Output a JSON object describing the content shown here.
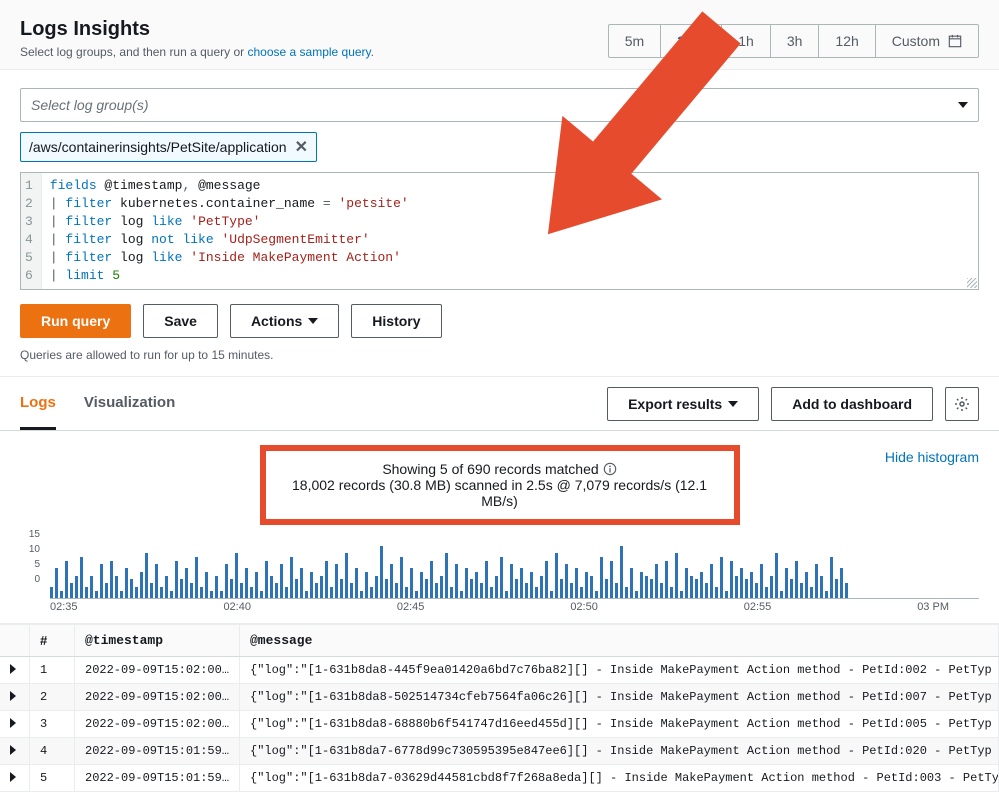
{
  "header": {
    "title": "Logs Insights",
    "subtitle_prefix": "Select log groups, and then run a query or ",
    "subtitle_link": "choose a sample query",
    "subtitle_suffix": "."
  },
  "timerange": {
    "items": [
      "5m",
      "30m",
      "1h",
      "3h",
      "12h"
    ],
    "active_index": 1,
    "custom": "Custom"
  },
  "log_select": {
    "placeholder": "Select log group(s)",
    "chip": "/aws/containerinsights/PetSite/application"
  },
  "editor": {
    "lines": [
      {
        "n": 1,
        "tokens": [
          [
            "kw",
            "fields"
          ],
          [
            "id",
            " @timestamp"
          ],
          [
            "op",
            ", "
          ],
          [
            "id",
            "@message"
          ]
        ]
      },
      {
        "n": 2,
        "tokens": [
          [
            "op",
            "| "
          ],
          [
            "kw",
            "filter"
          ],
          [
            "id",
            " kubernetes.container_name "
          ],
          [
            "op",
            "= "
          ],
          [
            "str",
            "'petsite'"
          ]
        ]
      },
      {
        "n": 3,
        "tokens": [
          [
            "op",
            "| "
          ],
          [
            "kw",
            "filter"
          ],
          [
            "id",
            " log "
          ],
          [
            "kw",
            "like"
          ],
          [
            "str",
            " 'PetType'"
          ]
        ]
      },
      {
        "n": 4,
        "tokens": [
          [
            "op",
            "| "
          ],
          [
            "kw",
            "filter"
          ],
          [
            "id",
            " log "
          ],
          [
            "kw",
            "not like"
          ],
          [
            "str",
            " 'UdpSegmentEmitter'"
          ]
        ]
      },
      {
        "n": 5,
        "tokens": [
          [
            "op",
            "| "
          ],
          [
            "kw",
            "filter"
          ],
          [
            "id",
            " log "
          ],
          [
            "kw",
            "like"
          ],
          [
            "str",
            " 'Inside MakePayment Action'"
          ]
        ]
      },
      {
        "n": 6,
        "tokens": [
          [
            "op",
            "| "
          ],
          [
            "kw",
            "limit"
          ],
          [
            "num",
            " 5"
          ]
        ]
      }
    ]
  },
  "buttons": {
    "run": "Run query",
    "save": "Save",
    "actions": "Actions",
    "history": "History"
  },
  "note": "Queries are allowed to run for up to 15 minutes.",
  "results": {
    "tabs": [
      "Logs",
      "Visualization"
    ],
    "active_tab": 0,
    "export": "Export results",
    "add_dashboard": "Add to dashboard",
    "hide_hist": "Hide histogram",
    "summary1": "Showing 5 of 690 records matched",
    "summary2": "18,002 records (30.8 MB) scanned in 2.5s @ 7,079 records/s (12.1 MB/s)"
  },
  "chart_data": {
    "type": "bar",
    "y_ticks": [
      "15",
      "10",
      "5",
      "0"
    ],
    "x_ticks": [
      "02:35",
      "02:40",
      "02:45",
      "02:50",
      "02:55",
      "03 PM"
    ],
    "ylim": [
      0,
      15
    ],
    "values": [
      3,
      8,
      2,
      10,
      4,
      6,
      11,
      3,
      6,
      2,
      9,
      4,
      10,
      6,
      2,
      8,
      5,
      3,
      7,
      12,
      4,
      9,
      3,
      6,
      2,
      10,
      5,
      8,
      4,
      11,
      3,
      7,
      2,
      6,
      2,
      9,
      5,
      12,
      4,
      8,
      3,
      7,
      2,
      10,
      6,
      4,
      9,
      3,
      11,
      5,
      8,
      2,
      7,
      4,
      6,
      10,
      3,
      9,
      5,
      12,
      4,
      8,
      2,
      7,
      3,
      6,
      14,
      5,
      9,
      4,
      11,
      3,
      8,
      2,
      7,
      5,
      10,
      4,
      6,
      12,
      3,
      9,
      2,
      8,
      5,
      7,
      4,
      10,
      3,
      6,
      11,
      2,
      9,
      5,
      8,
      4,
      7,
      3,
      6,
      10,
      2,
      12,
      5,
      9,
      4,
      8,
      3,
      7,
      6,
      2,
      11,
      5,
      10,
      4,
      14,
      3,
      8,
      2,
      7,
      6,
      5,
      9,
      4,
      10,
      3,
      12,
      2,
      8,
      6,
      5,
      7,
      4,
      9,
      3,
      11,
      2,
      10,
      6,
      8,
      5,
      7,
      4,
      9,
      3,
      6,
      12,
      2,
      8,
      5,
      10,
      4,
      7,
      3,
      9,
      6,
      2,
      11,
      5,
      8,
      4
    ]
  },
  "table": {
    "headers": {
      "num": "#",
      "ts": "@timestamp",
      "msg": "@message"
    },
    "rows": [
      {
        "n": "1",
        "ts": "2022-09-09T15:02:00…",
        "msg": "{\"log\":\"[1-631b8da8-445f9ea01420a6bd7c76ba82][] - Inside MakePayment Action method - PetId:002 - PetTyp"
      },
      {
        "n": "2",
        "ts": "2022-09-09T15:02:00…",
        "msg": "{\"log\":\"[1-631b8da8-502514734cfeb7564fa06c26][] - Inside MakePayment Action method - PetId:007 - PetTyp"
      },
      {
        "n": "3",
        "ts": "2022-09-09T15:02:00…",
        "msg": "{\"log\":\"[1-631b8da8-68880b6f541747d16eed455d][] - Inside MakePayment Action method - PetId:005 - PetTyp"
      },
      {
        "n": "4",
        "ts": "2022-09-09T15:01:59…",
        "msg": "{\"log\":\"[1-631b8da7-6778d99c730595395e847ee6][] - Inside MakePayment Action method - PetId:020 - PetTyp"
      },
      {
        "n": "5",
        "ts": "2022-09-09T15:01:59…",
        "msg": "{\"log\":\"[1-631b8da7-03629d44581cbd8f7f268a8eda][] - Inside MakePayment Action method - PetId:003 - PetTyp"
      }
    ]
  }
}
